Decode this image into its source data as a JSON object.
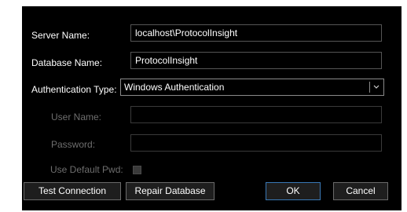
{
  "form": {
    "server_name_label": "Server Name:",
    "server_name_value": "localhost\\ProtocolInsight",
    "database_name_label": "Database Name:",
    "database_name_value": "ProtocolInsight",
    "auth_type_label": "Authentication Type:",
    "auth_type_value": "Windows Authentication",
    "user_name_label": "User Name:",
    "user_name_value": "",
    "password_label": "Password:",
    "password_value": "",
    "use_default_pwd_label": "Use Default Pwd:",
    "use_default_pwd_checked": false
  },
  "buttons": {
    "test_connection": "Test Connection",
    "repair_database": "Repair Database",
    "ok": "OK",
    "cancel": "Cancel"
  },
  "icons": {
    "dropdown": "chevron-down-icon"
  },
  "colors": {
    "background": "#000000",
    "text": "#ffffff",
    "disabled_text": "#6e6e6e",
    "default_button_border": "#3a78b5"
  }
}
